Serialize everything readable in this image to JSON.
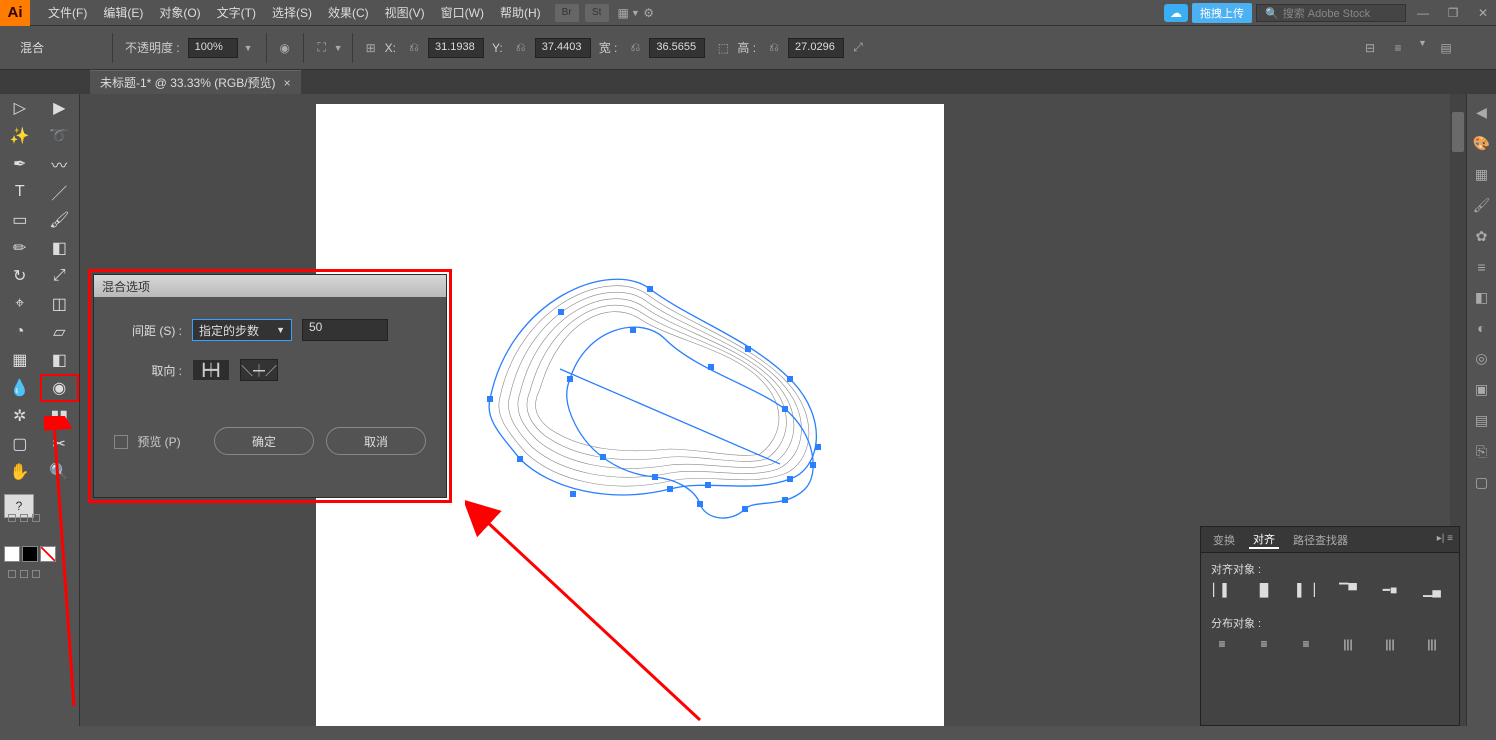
{
  "menubar": {
    "items": [
      "文件(F)",
      "编辑(E)",
      "对象(O)",
      "文字(T)",
      "选择(S)",
      "效果(C)",
      "视图(V)",
      "窗口(W)",
      "帮助(H)"
    ],
    "upload_label": "拖拽上传",
    "search_placeholder": "搜索 Adobe Stock"
  },
  "ctrlbar": {
    "mode": "混合",
    "opacity_label": "不透明度 :",
    "opacity_value": "100%",
    "x_label": "X:",
    "x_value": "31.1938",
    "y_label": "Y:",
    "y_value": "37.4403",
    "w_label": "宽 :",
    "w_value": "36.5655",
    "h_label": "高 :",
    "h_value": "27.0296"
  },
  "tab": {
    "title": "未标题-1* @ 33.33% (RGB/预览)"
  },
  "dialog": {
    "title": "混合选项",
    "spacing_label": "间距 (S) :",
    "spacing_mode": "指定的步数",
    "spacing_value": "50",
    "orientation_label": "取向 :",
    "preview_label": "预览 (P)",
    "ok": "确定",
    "cancel": "取消"
  },
  "align_panel": {
    "tabs": [
      "变换",
      "对齐",
      "路径查找器"
    ],
    "section1": "对齐对象 :",
    "section2": "分布对象 :"
  },
  "tool_question": "?"
}
